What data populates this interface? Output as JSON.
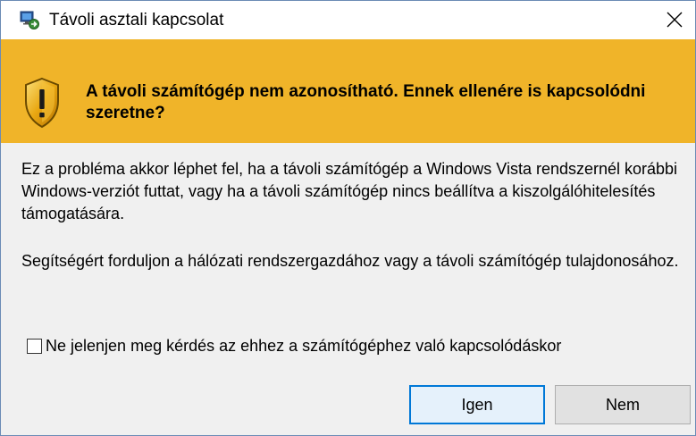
{
  "window": {
    "title": "Távoli asztali kapcsolat",
    "app_icon": "remote-desktop-icon",
    "close_icon": "close-icon"
  },
  "banner": {
    "icon": "warning-shield-icon",
    "color": "#f0b429",
    "heading": "A távoli számítógép nem azonosítható. Ennek ellenére is kapcsolódni szeretne?"
  },
  "body": {
    "paragraph1": "Ez a probléma akkor léphet fel, ha a távoli számítógép a Windows Vista rendszernél korábbi Windows-verziót futtat, vagy ha a távoli számítógép nincs beállítva a kiszolgálóhitelesítés támogatására.",
    "paragraph2": "Segítségért forduljon a hálózati rendszergazdához vagy a távoli számítógép tulajdonosához."
  },
  "checkbox": {
    "label": "Ne jelenjen meg kérdés az ehhez a számítógéphez való kapcsolódáskor",
    "checked": false
  },
  "buttons": {
    "yes_label": "Igen",
    "no_label": "Nem",
    "accent": "#0078d7"
  }
}
